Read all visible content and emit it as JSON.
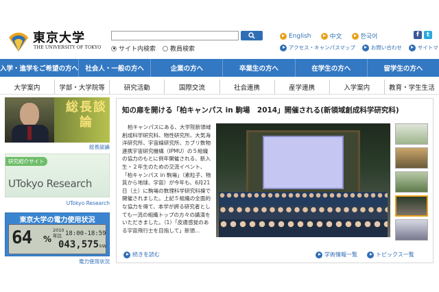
{
  "header": {
    "logo_jp": "東京大学",
    "logo_en": "THE UNIVERSITY OF TOKYO",
    "search": {
      "value": "",
      "placeholder": ""
    },
    "search_scope": [
      {
        "label": "サイト内検索",
        "selected": true
      },
      {
        "label": "教員検索",
        "selected": false
      }
    ],
    "languages": [
      "English",
      "中文",
      "한국어"
    ],
    "utility_links": [
      "アクセス・キャンパスマップ",
      "お問い合わせ",
      "サイトマップ"
    ],
    "social": {
      "facebook": "f",
      "twitter": "t"
    }
  },
  "primary_nav": [
    "入学・進学をご希望の方へ",
    "社会人・一般の方へ",
    "企業の方へ",
    "卒業生の方へ",
    "在学生の方へ",
    "留学生の方へ"
  ],
  "secondary_nav": [
    "大学案内",
    "学部・大学院等",
    "研究活動",
    "国際交流",
    "社会連携",
    "産学連携",
    "入学案内",
    "教育・学生生活"
  ],
  "sidebar": {
    "president": {
      "title": "総長談論",
      "caption": "総長談論"
    },
    "research": {
      "tag": "研究紹介サイト",
      "title": "UTokyo Research",
      "caption": "UTokyo Research"
    },
    "power": {
      "heading": "東京大学の電力使用状況",
      "percent": "64",
      "percent_sign": "%",
      "year": "2010",
      "year_label": "年比",
      "time_range": "18:00-18:59",
      "time_label": "電力",
      "kw": "043,575",
      "unit": "kW",
      "caption": "電力使用状況"
    }
  },
  "article": {
    "title": "知の扉を開ける「柏キャンパス in 駒場　2014」開催される(新領域創成科学研究科)",
    "body": "柏キャンパスにある、大学院新領域創成科学研究科、物性研究所、大気海洋研究所、宇宙線研究所、カブリ数物連携宇宙研究機構（IPMU）の５組織の協力のもとに例年開催される、新入生・２年生のための交流イベント、「柏キャンパス in 駒場」（素粒子、物質から地球、宇宙）が今年も、6月21日（土）に駒場の数理科学研究科棟で開催されました。上記５組織の全面的な協力を得て、本学が誇る研究者としても一流の組織トップの方々の講演をいただきました。（1）「皮膚感覚のある宇宙飛行士を目指して」新領...",
    "more": "続きを読む",
    "links": [
      "学術情報一覧",
      "トピックス一覧"
    ]
  },
  "colors": {
    "brand_blue": "#3378c2",
    "accent_orange": "#e7a21c",
    "link_blue": "#2f6eb5"
  }
}
